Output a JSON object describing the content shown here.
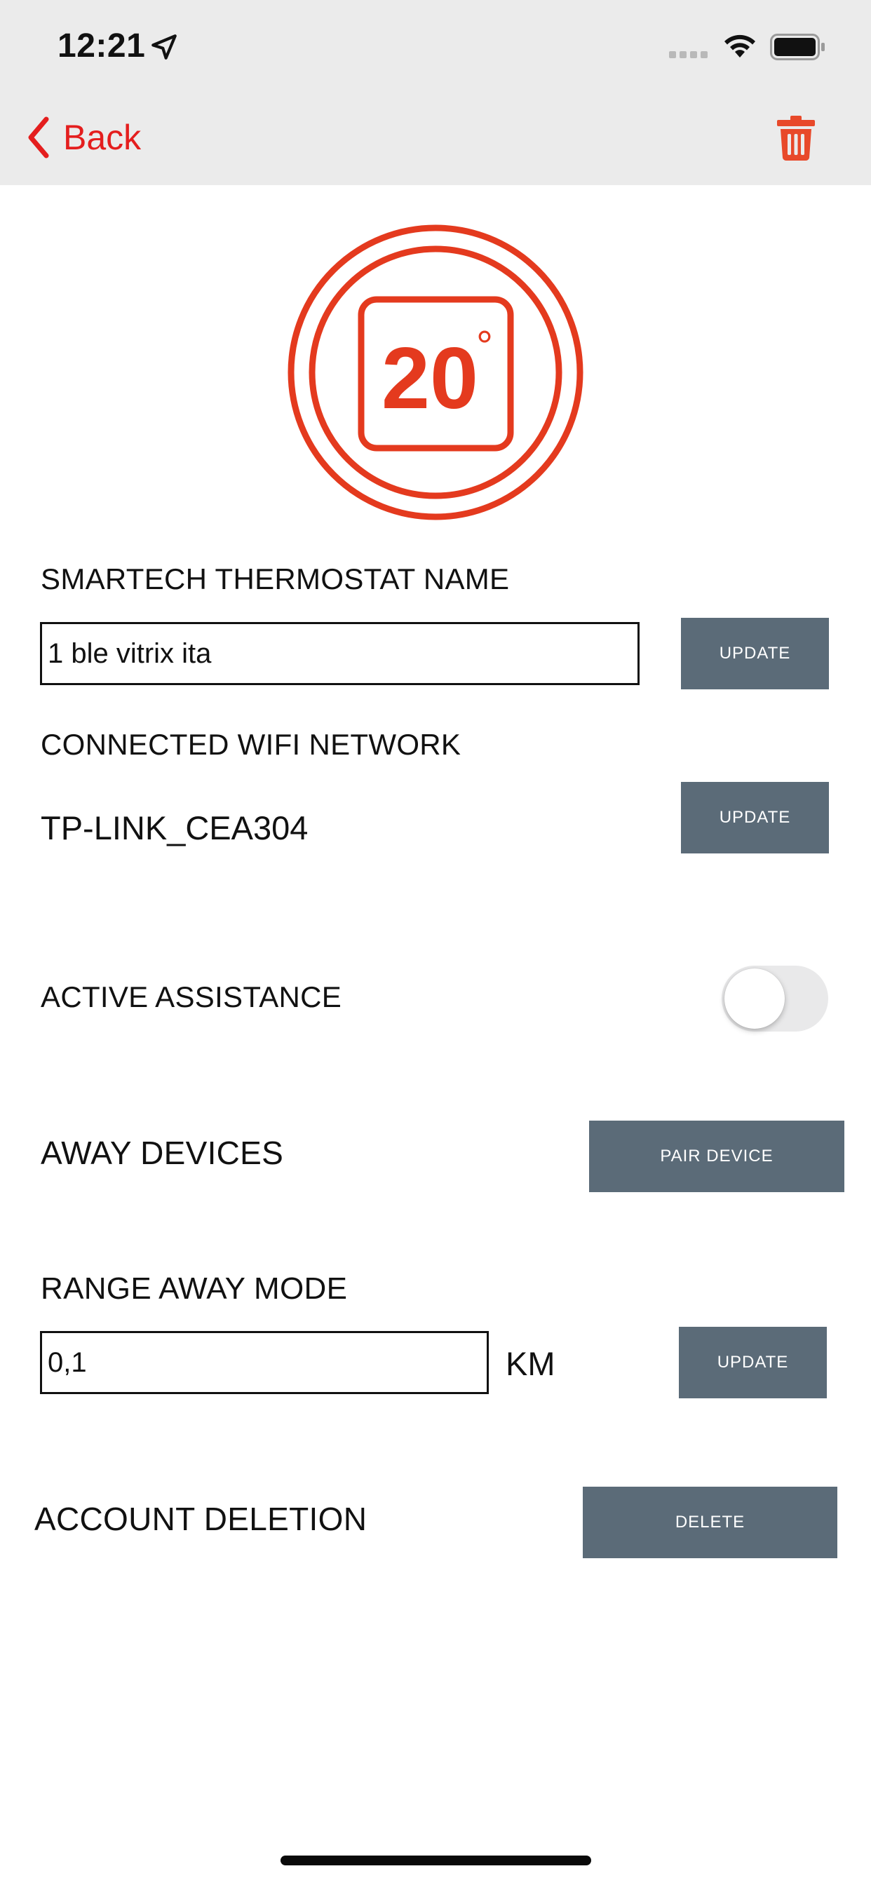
{
  "status_bar": {
    "time": "12:21",
    "icons": [
      "location-arrow-icon",
      "signal-icon",
      "wifi-icon",
      "battery-icon"
    ]
  },
  "nav": {
    "back_label": "Back",
    "back_icon": "chevron-left-icon",
    "delete_icon": "trash-icon",
    "accent_color": "#e41e1e"
  },
  "device": {
    "icon": "thermostat-icon",
    "temperature": "20",
    "degree": "°",
    "icon_color": "#e43a1e"
  },
  "thermostat_name": {
    "label": "SMARTECH THERMOSTAT NAME",
    "value": "1 ble vitrix ita",
    "button": "UPDATE"
  },
  "wifi": {
    "label": "CONNECTED WIFI NETWORK",
    "network": "TP-LINK_CEA304",
    "button": "UPDATE"
  },
  "assistance": {
    "label": "ACTIVE ASSISTANCE",
    "enabled": false
  },
  "away_devices": {
    "label": "AWAY DEVICES",
    "button": "PAIR DEVICE"
  },
  "range": {
    "label": "RANGE AWAY MODE",
    "value": "0,1",
    "unit": "KM",
    "button": "UPDATE"
  },
  "account": {
    "label": "ACCOUNT DELETION",
    "button": "DELETE"
  },
  "button_color": "#5b6b78"
}
